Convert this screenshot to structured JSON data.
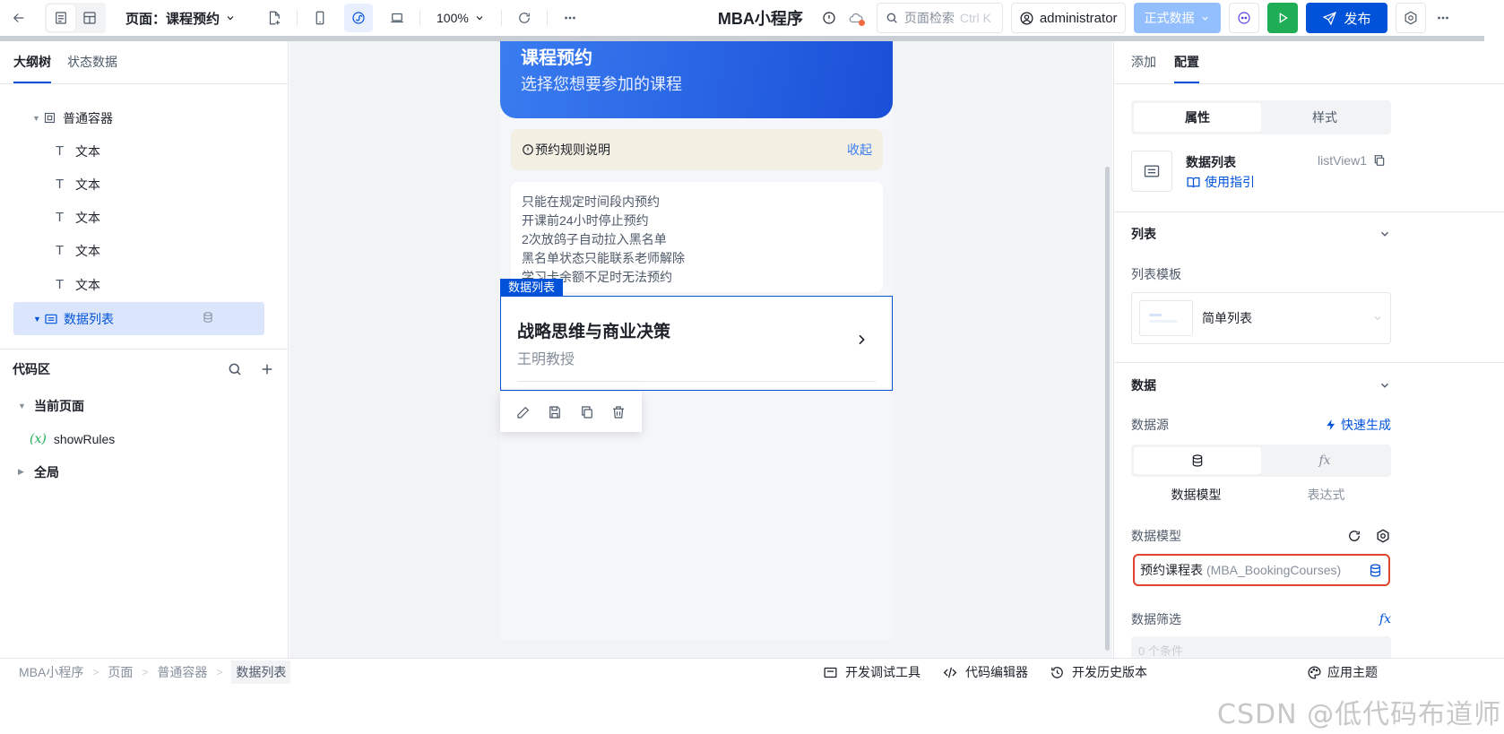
{
  "topbar": {
    "page_selector": "页面：课程预约",
    "zoom": "100%",
    "app_title": "MBA小程序",
    "search_placeholder": "页面检索",
    "search_shortcut": "Ctrl K",
    "user": "administrator",
    "env": "正式数据",
    "publish": "发布",
    "colors": {
      "publish": "#0052d9",
      "run": "#1fae56",
      "env": "#94bffe"
    }
  },
  "left": {
    "tabs": [
      "大纲树",
      "状态数据"
    ],
    "tree": {
      "container": "普通容器",
      "texts": [
        "文本",
        "文本",
        "文本",
        "文本",
        "文本"
      ],
      "list": "数据列表"
    },
    "code": {
      "title": "代码区",
      "current_page": "当前页面",
      "variable_prefix": "(x)",
      "variable": "showRules",
      "global": "全局"
    }
  },
  "canvas": {
    "hero_title": "课程预约",
    "hero_subtitle": "选择您想要参加的课程",
    "rules_title": "预约规则说明",
    "rules_toggle": "收起",
    "rules": [
      "只能在规定时间段内预约",
      "开课前24小时停止预约",
      "2次放鸽子自动拉入黑名单",
      "黑名单状态只能联系老师解除",
      "学习卡余额不足时无法预约"
    ],
    "selection_tag": "数据列表",
    "course": {
      "title": "战略思维与商业决策",
      "teacher": "王明教授"
    }
  },
  "right": {
    "tabs": [
      "添加",
      "配置"
    ],
    "subtabs": [
      "属性",
      "样式"
    ],
    "component": {
      "name": "数据列表",
      "guide": "使用指引",
      "id": "listView1"
    },
    "list_section": {
      "title": "列表",
      "template_label": "列表模板",
      "template_value": "简单列表"
    },
    "data_section": {
      "title": "数据",
      "source_label": "数据源",
      "quick_generate": "快速生成",
      "source_options": [
        "数据模型",
        "表达式"
      ],
      "model_label": "数据模型",
      "model_name": "预约课程表",
      "model_api": "(MBA_BookingCourses)",
      "filter_label": "数据筛选",
      "filter_placeholder": "0 个条件"
    }
  },
  "bottombar": {
    "breadcrumb": [
      "MBA小程序",
      "页面",
      "普通容器",
      "数据列表"
    ],
    "tools": [
      "开发调试工具",
      "代码编辑器",
      "开发历史版本"
    ],
    "theme": "应用主题"
  },
  "watermark": "CSDN @低代码布道师"
}
